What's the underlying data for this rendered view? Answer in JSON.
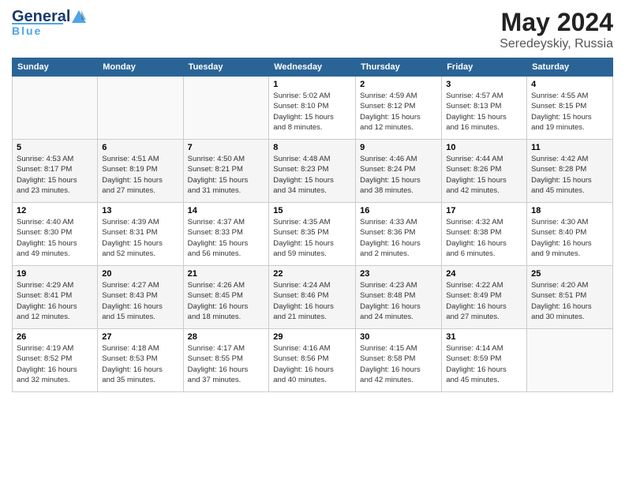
{
  "header": {
    "logo_line1": "General",
    "logo_line2": "Blue",
    "title": "May 2024",
    "location": "Seredeyskiy, Russia"
  },
  "weekdays": [
    "Sunday",
    "Monday",
    "Tuesday",
    "Wednesday",
    "Thursday",
    "Friday",
    "Saturday"
  ],
  "weeks": [
    [
      {
        "day": "",
        "info": ""
      },
      {
        "day": "",
        "info": ""
      },
      {
        "day": "",
        "info": ""
      },
      {
        "day": "1",
        "info": "Sunrise: 5:02 AM\nSunset: 8:10 PM\nDaylight: 15 hours\nand 8 minutes."
      },
      {
        "day": "2",
        "info": "Sunrise: 4:59 AM\nSunset: 8:12 PM\nDaylight: 15 hours\nand 12 minutes."
      },
      {
        "day": "3",
        "info": "Sunrise: 4:57 AM\nSunset: 8:13 PM\nDaylight: 15 hours\nand 16 minutes."
      },
      {
        "day": "4",
        "info": "Sunrise: 4:55 AM\nSunset: 8:15 PM\nDaylight: 15 hours\nand 19 minutes."
      }
    ],
    [
      {
        "day": "5",
        "info": "Sunrise: 4:53 AM\nSunset: 8:17 PM\nDaylight: 15 hours\nand 23 minutes."
      },
      {
        "day": "6",
        "info": "Sunrise: 4:51 AM\nSunset: 8:19 PM\nDaylight: 15 hours\nand 27 minutes."
      },
      {
        "day": "7",
        "info": "Sunrise: 4:50 AM\nSunset: 8:21 PM\nDaylight: 15 hours\nand 31 minutes."
      },
      {
        "day": "8",
        "info": "Sunrise: 4:48 AM\nSunset: 8:23 PM\nDaylight: 15 hours\nand 34 minutes."
      },
      {
        "day": "9",
        "info": "Sunrise: 4:46 AM\nSunset: 8:24 PM\nDaylight: 15 hours\nand 38 minutes."
      },
      {
        "day": "10",
        "info": "Sunrise: 4:44 AM\nSunset: 8:26 PM\nDaylight: 15 hours\nand 42 minutes."
      },
      {
        "day": "11",
        "info": "Sunrise: 4:42 AM\nSunset: 8:28 PM\nDaylight: 15 hours\nand 45 minutes."
      }
    ],
    [
      {
        "day": "12",
        "info": "Sunrise: 4:40 AM\nSunset: 8:30 PM\nDaylight: 15 hours\nand 49 minutes."
      },
      {
        "day": "13",
        "info": "Sunrise: 4:39 AM\nSunset: 8:31 PM\nDaylight: 15 hours\nand 52 minutes."
      },
      {
        "day": "14",
        "info": "Sunrise: 4:37 AM\nSunset: 8:33 PM\nDaylight: 15 hours\nand 56 minutes."
      },
      {
        "day": "15",
        "info": "Sunrise: 4:35 AM\nSunset: 8:35 PM\nDaylight: 15 hours\nand 59 minutes."
      },
      {
        "day": "16",
        "info": "Sunrise: 4:33 AM\nSunset: 8:36 PM\nDaylight: 16 hours\nand 2 minutes."
      },
      {
        "day": "17",
        "info": "Sunrise: 4:32 AM\nSunset: 8:38 PM\nDaylight: 16 hours\nand 6 minutes."
      },
      {
        "day": "18",
        "info": "Sunrise: 4:30 AM\nSunset: 8:40 PM\nDaylight: 16 hours\nand 9 minutes."
      }
    ],
    [
      {
        "day": "19",
        "info": "Sunrise: 4:29 AM\nSunset: 8:41 PM\nDaylight: 16 hours\nand 12 minutes."
      },
      {
        "day": "20",
        "info": "Sunrise: 4:27 AM\nSunset: 8:43 PM\nDaylight: 16 hours\nand 15 minutes."
      },
      {
        "day": "21",
        "info": "Sunrise: 4:26 AM\nSunset: 8:45 PM\nDaylight: 16 hours\nand 18 minutes."
      },
      {
        "day": "22",
        "info": "Sunrise: 4:24 AM\nSunset: 8:46 PM\nDaylight: 16 hours\nand 21 minutes."
      },
      {
        "day": "23",
        "info": "Sunrise: 4:23 AM\nSunset: 8:48 PM\nDaylight: 16 hours\nand 24 minutes."
      },
      {
        "day": "24",
        "info": "Sunrise: 4:22 AM\nSunset: 8:49 PM\nDaylight: 16 hours\nand 27 minutes."
      },
      {
        "day": "25",
        "info": "Sunrise: 4:20 AM\nSunset: 8:51 PM\nDaylight: 16 hours\nand 30 minutes."
      }
    ],
    [
      {
        "day": "26",
        "info": "Sunrise: 4:19 AM\nSunset: 8:52 PM\nDaylight: 16 hours\nand 32 minutes."
      },
      {
        "day": "27",
        "info": "Sunrise: 4:18 AM\nSunset: 8:53 PM\nDaylight: 16 hours\nand 35 minutes."
      },
      {
        "day": "28",
        "info": "Sunrise: 4:17 AM\nSunset: 8:55 PM\nDaylight: 16 hours\nand 37 minutes."
      },
      {
        "day": "29",
        "info": "Sunrise: 4:16 AM\nSunset: 8:56 PM\nDaylight: 16 hours\nand 40 minutes."
      },
      {
        "day": "30",
        "info": "Sunrise: 4:15 AM\nSunset: 8:58 PM\nDaylight: 16 hours\nand 42 minutes."
      },
      {
        "day": "31",
        "info": "Sunrise: 4:14 AM\nSunset: 8:59 PM\nDaylight: 16 hours\nand 45 minutes."
      },
      {
        "day": "",
        "info": ""
      }
    ]
  ]
}
